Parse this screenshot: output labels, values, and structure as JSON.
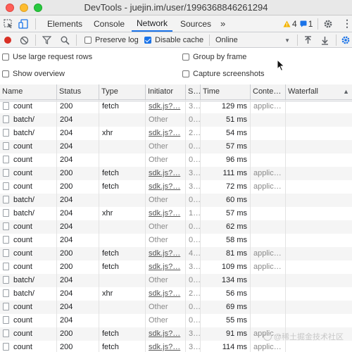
{
  "window": {
    "title": "DevTools - juejin.im/user/1996368846261294"
  },
  "main_tabs": [
    {
      "label": "Elements"
    },
    {
      "label": "Console"
    },
    {
      "label": "Network"
    },
    {
      "label": "Sources"
    }
  ],
  "more_tabs": "»",
  "badges": {
    "warnings": "4",
    "messages": "1"
  },
  "toolbar": {
    "preserve_log": "Preserve log",
    "disable_cache": "Disable cache",
    "throttling": "Online"
  },
  "settings": {
    "large_rows": "Use large request rows",
    "group_by_frame": "Group by frame",
    "show_overview": "Show overview",
    "capture_screenshots": "Capture screenshots"
  },
  "columns": [
    "Name",
    "Status",
    "Type",
    "Initiator",
    "S…",
    "Time",
    "Conte…",
    "Waterfall"
  ],
  "rows": [
    {
      "name": "count",
      "status": "200",
      "type": "fetch",
      "initiator": "sdk.js?…",
      "size": "3…",
      "time": "129 ms",
      "content": "applic…"
    },
    {
      "name": "batch/",
      "status": "204",
      "type": "",
      "initiator": "Other",
      "size": "0…",
      "time": "51 ms",
      "content": ""
    },
    {
      "name": "batch/",
      "status": "204",
      "type": "xhr",
      "initiator": "sdk.js?…",
      "size": "2…",
      "time": "54 ms",
      "content": ""
    },
    {
      "name": "count",
      "status": "204",
      "type": "",
      "initiator": "Other",
      "size": "0…",
      "time": "57 ms",
      "content": ""
    },
    {
      "name": "count",
      "status": "204",
      "type": "",
      "initiator": "Other",
      "size": "0…",
      "time": "96 ms",
      "content": ""
    },
    {
      "name": "count",
      "status": "200",
      "type": "fetch",
      "initiator": "sdk.js?…",
      "size": "3…",
      "time": "111 ms",
      "content": "applic…"
    },
    {
      "name": "count",
      "status": "200",
      "type": "fetch",
      "initiator": "sdk.js?…",
      "size": "3…",
      "time": "72 ms",
      "content": "applic…"
    },
    {
      "name": "batch/",
      "status": "204",
      "type": "",
      "initiator": "Other",
      "size": "0…",
      "time": "60 ms",
      "content": ""
    },
    {
      "name": "batch/",
      "status": "204",
      "type": "xhr",
      "initiator": "sdk.js?…",
      "size": "1…",
      "time": "57 ms",
      "content": ""
    },
    {
      "name": "count",
      "status": "204",
      "type": "",
      "initiator": "Other",
      "size": "0…",
      "time": "62 ms",
      "content": ""
    },
    {
      "name": "count",
      "status": "204",
      "type": "",
      "initiator": "Other",
      "size": "0…",
      "time": "58 ms",
      "content": ""
    },
    {
      "name": "count",
      "status": "200",
      "type": "fetch",
      "initiator": "sdk.js?…",
      "size": "4…",
      "time": "81 ms",
      "content": "applic…"
    },
    {
      "name": "count",
      "status": "200",
      "type": "fetch",
      "initiator": "sdk.js?…",
      "size": "3…",
      "time": "109 ms",
      "content": "applic…"
    },
    {
      "name": "batch/",
      "status": "204",
      "type": "",
      "initiator": "Other",
      "size": "0…",
      "time": "134 ms",
      "content": ""
    },
    {
      "name": "batch/",
      "status": "204",
      "type": "xhr",
      "initiator": "sdk.js?…",
      "size": "2…",
      "time": "56 ms",
      "content": ""
    },
    {
      "name": "count",
      "status": "204",
      "type": "",
      "initiator": "Other",
      "size": "0…",
      "time": "69 ms",
      "content": ""
    },
    {
      "name": "count",
      "status": "204",
      "type": "",
      "initiator": "Other",
      "size": "0…",
      "time": "55 ms",
      "content": ""
    },
    {
      "name": "count",
      "status": "200",
      "type": "fetch",
      "initiator": "sdk.js?…",
      "size": "3…",
      "time": "91 ms",
      "content": "applic…"
    },
    {
      "name": "count",
      "status": "200",
      "type": "fetch",
      "initiator": "sdk.js?…",
      "size": "3…",
      "time": "114 ms",
      "content": "applic…"
    }
  ],
  "watermark": "@稀土掘金技术社区",
  "colors": {
    "accent": "#1a73e8",
    "record": "#d93025",
    "warning": "#f4b400"
  }
}
